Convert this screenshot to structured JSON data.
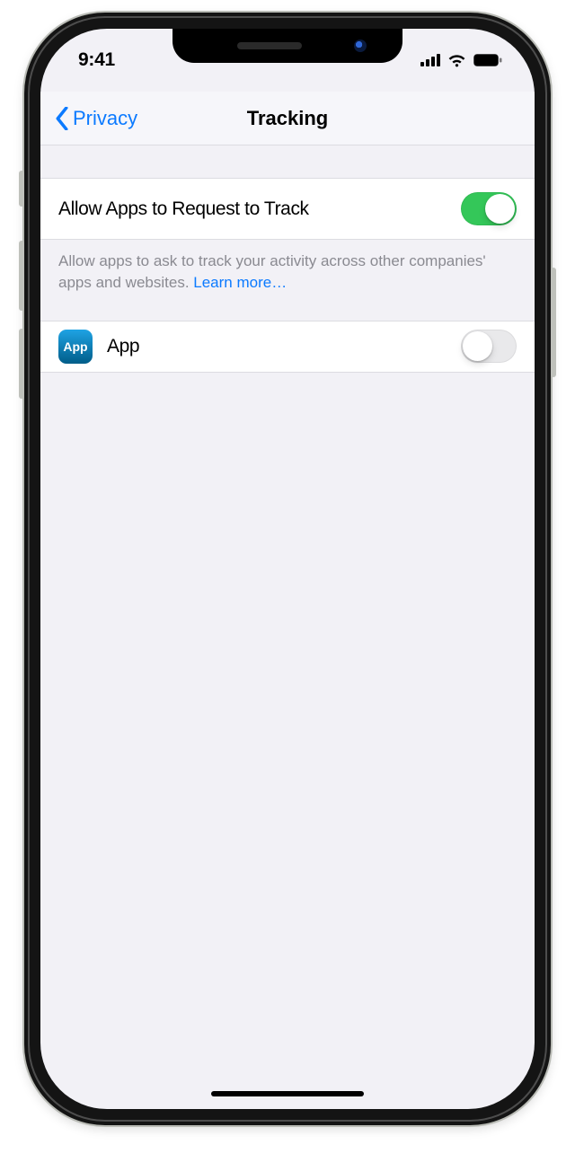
{
  "status": {
    "time": "9:41"
  },
  "nav": {
    "back_label": "Privacy",
    "title": "Tracking"
  },
  "allow_row": {
    "label": "Allow Apps to Request to Track",
    "on": true
  },
  "footer": {
    "text": "Allow apps to ask to track your activity across other companies' apps and websites. ",
    "link": "Learn more…"
  },
  "app_row": {
    "icon_text": "App",
    "label": "App",
    "on": false
  }
}
